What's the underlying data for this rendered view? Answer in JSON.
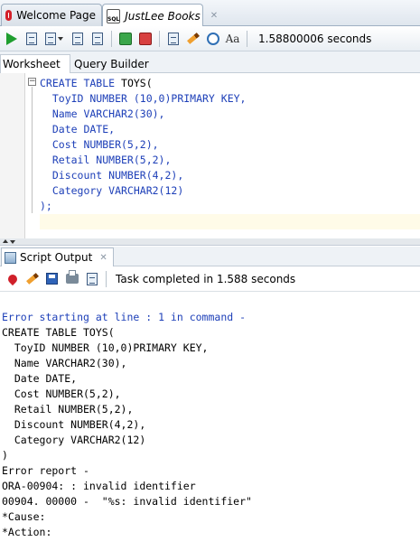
{
  "doc_tabs": [
    {
      "label": "Welcome Page",
      "icon": "oracle-icon",
      "active": false
    },
    {
      "label": "JustLee Books",
      "icon": "sql-worksheet-icon",
      "active": true
    }
  ],
  "toolbar": {
    "elapsed": "1.58800006 seconds",
    "buttons": [
      "run-statement",
      "run-script",
      "autotrace",
      "explain-plan",
      "sql-tuning",
      "commit",
      "rollback",
      "unshared-sql",
      "clear",
      "history",
      "format"
    ]
  },
  "worksheet_tabs": [
    {
      "label": "Worksheet",
      "active": true
    },
    {
      "label": "Query Builder",
      "active": false
    }
  ],
  "editor": {
    "lines": [
      {
        "kw": "CREATE TABLE ",
        "id": "TOYS("
      },
      {
        "kw": "  ToyID NUMBER (10,0)PRIMARY KEY,",
        "id": ""
      },
      {
        "kw": "  Name VARCHAR2(30),",
        "id": ""
      },
      {
        "kw": "  Date DATE,",
        "id": ""
      },
      {
        "kw": "  Cost NUMBER(5,2),",
        "id": ""
      },
      {
        "kw": "  Retail NUMBER(5,2),",
        "id": ""
      },
      {
        "kw": "  Discount NUMBER(4,2),",
        "id": ""
      },
      {
        "kw": "  Category VARCHAR2(12)",
        "id": ""
      },
      {
        "kw": ");",
        "id": ""
      }
    ]
  },
  "script_output": {
    "tab_label": "Script Output",
    "status": "Task completed in 1.588 seconds",
    "lines": [
      {
        "text": "Error starting at line : 1 in command -",
        "style": "err"
      },
      {
        "text": "CREATE TABLE TOYS(",
        "style": ""
      },
      {
        "text": "  ToyID NUMBER (10,0)PRIMARY KEY,",
        "style": ""
      },
      {
        "text": "  Name VARCHAR2(30),",
        "style": ""
      },
      {
        "text": "  Date DATE,",
        "style": ""
      },
      {
        "text": "  Cost NUMBER(5,2),",
        "style": ""
      },
      {
        "text": "  Retail NUMBER(5,2),",
        "style": ""
      },
      {
        "text": "  Discount NUMBER(4,2),",
        "style": ""
      },
      {
        "text": "  Category VARCHAR2(12)",
        "style": ""
      },
      {
        "text": ")",
        "style": ""
      },
      {
        "text": "Error report -",
        "style": ""
      },
      {
        "text": "ORA-00904: : invalid identifier",
        "style": ""
      },
      {
        "text": "00904. 00000 -  \"%s: invalid identifier\"",
        "style": ""
      },
      {
        "text": "*Cause:",
        "style": ""
      },
      {
        "text": "*Action:",
        "style": ""
      }
    ]
  }
}
